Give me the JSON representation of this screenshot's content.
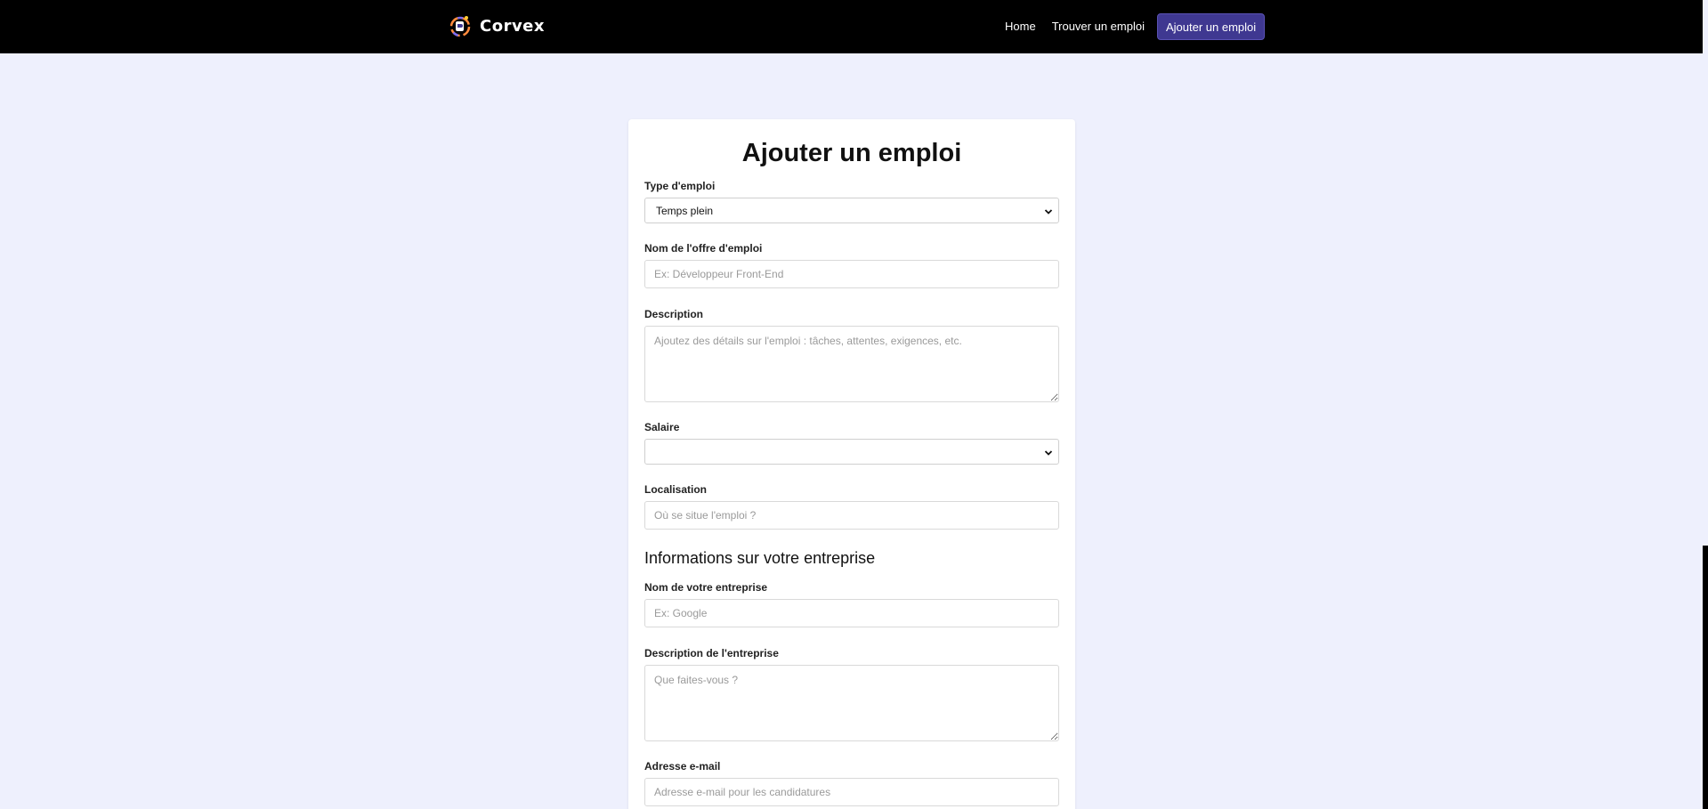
{
  "header": {
    "brand": "Corvex",
    "nav": [
      {
        "label": "Home"
      },
      {
        "label": "Trouver un emploi"
      },
      {
        "label": "Ajouter un emploi"
      }
    ]
  },
  "form": {
    "title": "Ajouter un emploi",
    "job_type": {
      "label": "Type d'emploi",
      "value": "Temps plein"
    },
    "job_name": {
      "label": "Nom de l'offre d'emploi",
      "placeholder": "Ex: Développeur Front-End"
    },
    "description": {
      "label": "Description",
      "placeholder": "Ajoutez des détails sur l'emploi : tâches, attentes, exigences, etc."
    },
    "salary": {
      "label": "Salaire",
      "value": ""
    },
    "location": {
      "label": "Localisation",
      "placeholder": "Où se situe l'emploi ?"
    },
    "company_section": "Informations sur votre entreprise",
    "company_name": {
      "label": "Nom de votre entreprise",
      "placeholder": "Ex: Google"
    },
    "company_description": {
      "label": "Description de l'entreprise",
      "placeholder": "Que faites-vous ?"
    },
    "email": {
      "label": "Adresse e-mail",
      "placeholder": "Adresse e-mail pour les candidatures"
    }
  },
  "colors": {
    "navbar": "#000000",
    "page_background": "#eef0fd",
    "active_nav": "#3f3891"
  }
}
